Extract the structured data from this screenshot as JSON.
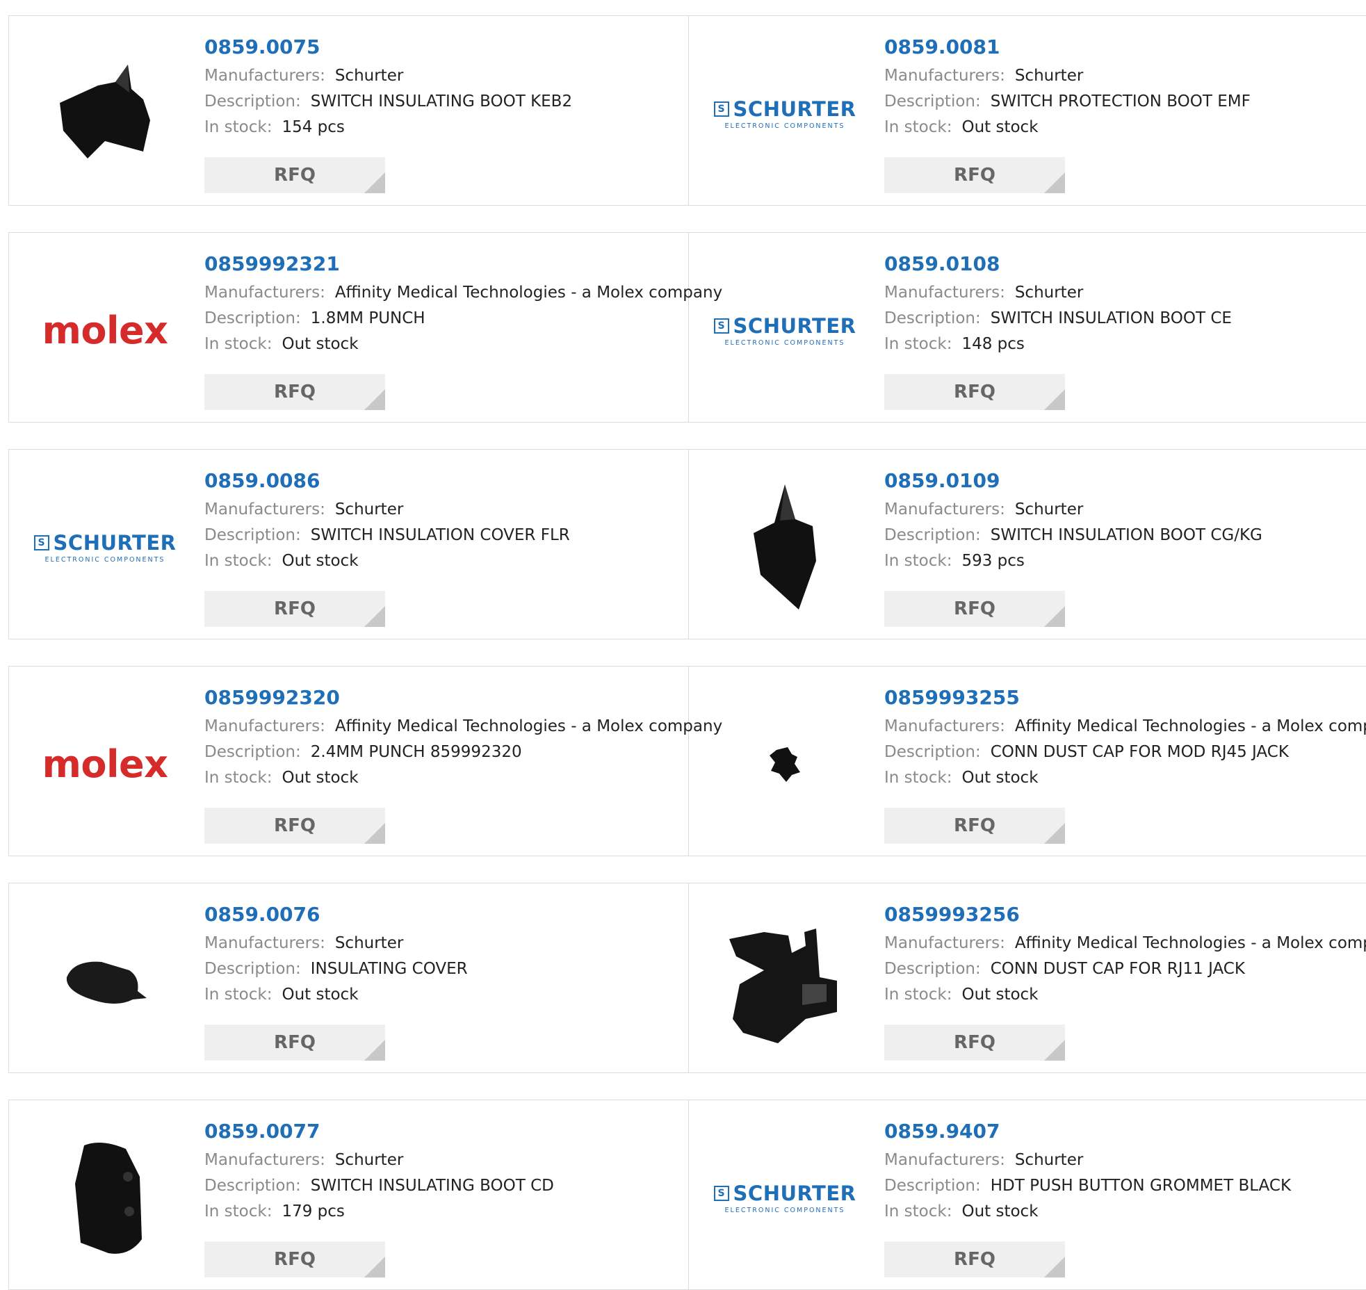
{
  "labels": {
    "manufacturer": "Manufacturers:",
    "description": "Description:",
    "stock": "In stock:",
    "rfq": "RFQ"
  },
  "brand_logos": {
    "schurter": {
      "name": "SCHURTER",
      "tagline": "ELECTRONIC COMPONENTS",
      "mark": "S",
      "color": "#1f6eb8"
    },
    "molex": {
      "name": "molex",
      "color": "#d62b2b"
    }
  },
  "colors": {
    "link": "#1f6eb8",
    "label": "#8a8a8a",
    "button_bg": "#efefef"
  },
  "products": [
    {
      "part": "0859.0075",
      "manufacturer": "Schurter",
      "description": "SWITCH INSULATING BOOT KEB2",
      "stock": "154 pcs",
      "image": "boot-horn"
    },
    {
      "part": "0859.0081",
      "manufacturer": "Schurter",
      "description": "SWITCH PROTECTION BOOT EMF",
      "stock": "Out stock",
      "image": "schurter"
    },
    {
      "part": "0859992321",
      "manufacturer": "Affinity Medical Technologies - a Molex company",
      "description": "1.8MM PUNCH",
      "stock": "Out stock",
      "image": "molex"
    },
    {
      "part": "0859.0108",
      "manufacturer": "Schurter",
      "description": "SWITCH INSULATION BOOT CE",
      "stock": "148 pcs",
      "image": "schurter"
    },
    {
      "part": "0859.0086",
      "manufacturer": "Schurter",
      "description": "SWITCH INSULATION COVER FLR",
      "stock": "Out stock",
      "image": "schurter"
    },
    {
      "part": "0859.0109",
      "manufacturer": "Schurter",
      "description": "SWITCH INSULATION BOOT CG/KG",
      "stock": "593 pcs",
      "image": "boot-tall"
    },
    {
      "part": "0859992320",
      "manufacturer": "Affinity Medical Technologies - a Molex company",
      "description": "2.4MM PUNCH 859992320",
      "stock": "Out stock",
      "image": "molex"
    },
    {
      "part": "0859993255",
      "manufacturer": "Affinity Medical Technologies - a Molex company",
      "description": "CONN DUST CAP FOR MOD RJ45 JACK",
      "stock": "Out stock",
      "image": "cap-small"
    },
    {
      "part": "0859.0076",
      "manufacturer": "Schurter",
      "description": "INSULATING COVER",
      "stock": "Out stock",
      "image": "cover-flat"
    },
    {
      "part": "0859993256",
      "manufacturer": "Affinity Medical Technologies - a Molex company",
      "description": "CONN DUST CAP FOR RJ11 JACK",
      "stock": "Out stock",
      "image": "cap-rj11"
    },
    {
      "part": "0859.0077",
      "manufacturer": "Schurter",
      "description": "SWITCH INSULATING BOOT CD",
      "stock": "179 pcs",
      "image": "boot-box"
    },
    {
      "part": "0859.9407",
      "manufacturer": "Schurter",
      "description": "HDT PUSH BUTTON GROMMET BLACK",
      "stock": "Out stock",
      "image": "schurter"
    }
  ]
}
